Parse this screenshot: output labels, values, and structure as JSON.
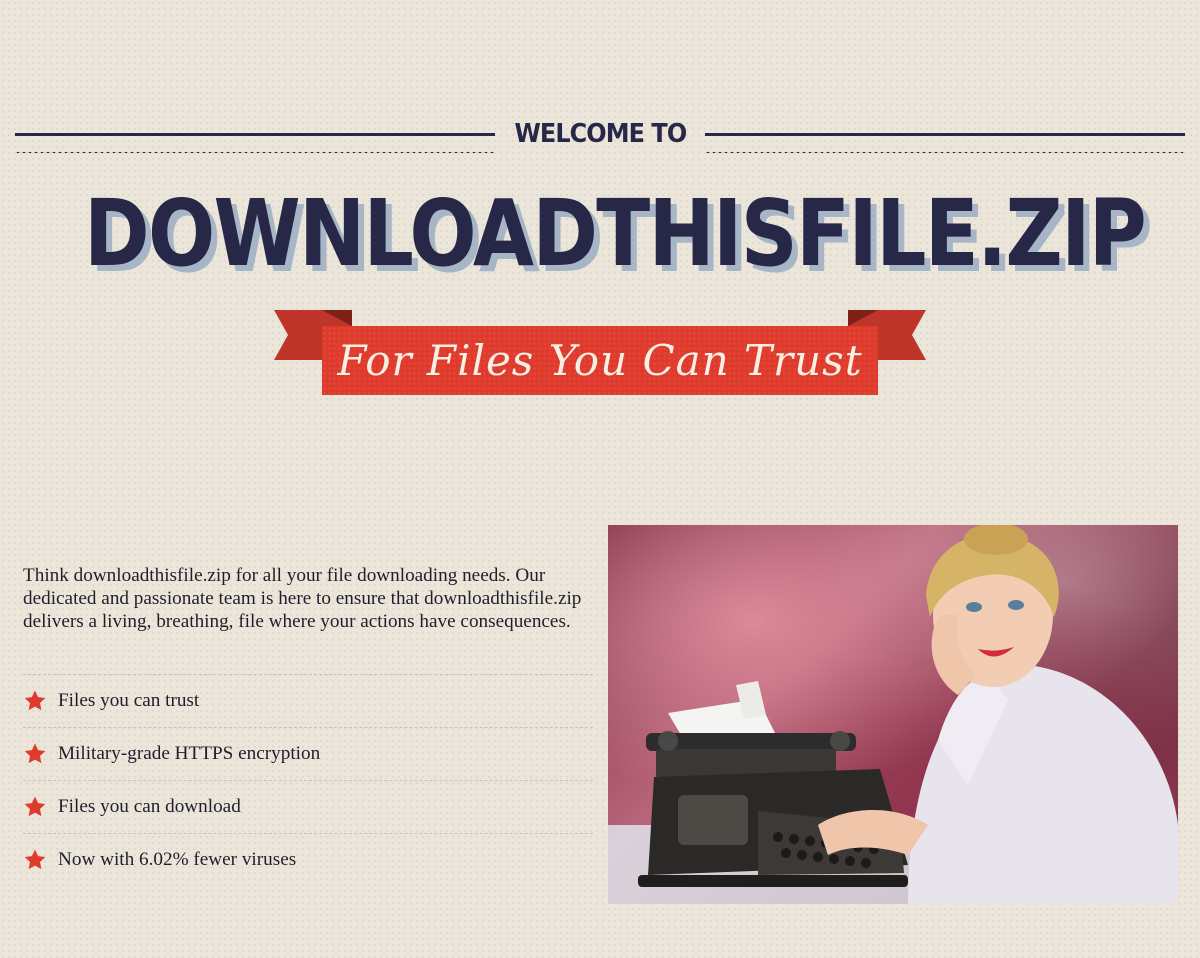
{
  "header": {
    "welcome": "WELCOME TO",
    "site_title": "DOWNLOADTHISFILE.ZIP",
    "tagline": "For Files You Can Trust"
  },
  "intro": {
    "text": "Think downloadthisfile.zip for all your file downloading needs. Our dedicated and passionate team is here to ensure that downloadthisfile.zip delivers a living, breathing, file where your actions have consequences."
  },
  "features": [
    {
      "icon": "star-icon",
      "label": "Files you can trust"
    },
    {
      "icon": "star-icon",
      "label": "Military-grade HTTPS encryption"
    },
    {
      "icon": "star-icon",
      "label": "Files you can download"
    },
    {
      "icon": "star-icon",
      "label": "Now with 6.02% fewer viruses"
    }
  ],
  "colors": {
    "navy": "#272848",
    "red": "#df3b2c",
    "background": "#ebe5da",
    "title_shadow": "#a7b6c6"
  }
}
